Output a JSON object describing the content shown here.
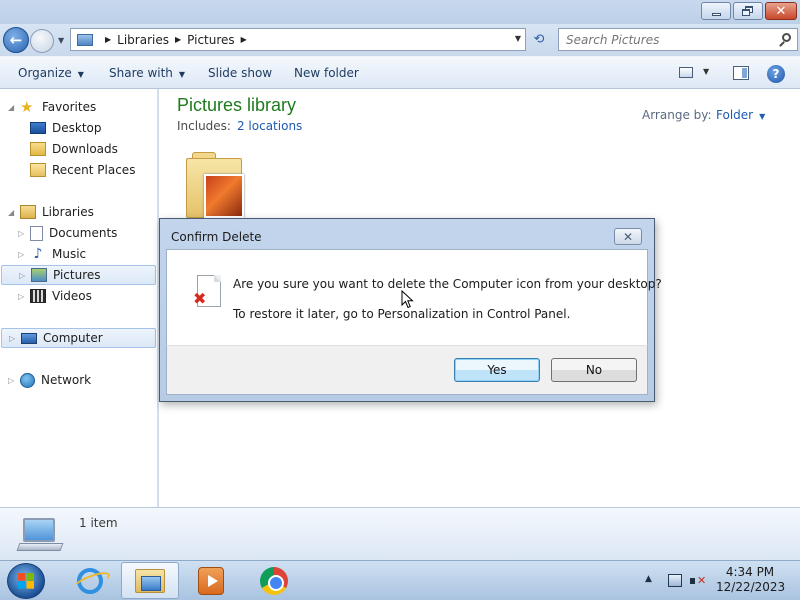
{
  "window": {
    "minimize_icon": "minimize-icon",
    "maximize_icon": "restore-icon",
    "close_icon": "close-icon",
    "close_glyph": "✕"
  },
  "address": {
    "back_icon": "back-arrow-icon",
    "back_glyph": "←",
    "forward_icon": "forward-arrow-icon",
    "history_glyph": "▼",
    "breadcrumbs": [
      "Libraries",
      "Pictures"
    ],
    "separator": "▶",
    "dropdown_glyph": "▼",
    "refresh_glyph": "⟲",
    "search_placeholder": "Search Pictures"
  },
  "toolbar": {
    "organize": "Organize",
    "share_with": "Share with",
    "slide_show": "Slide show",
    "new_folder": "New folder",
    "dropdown_glyph": "▼",
    "help_glyph": "?"
  },
  "nav": {
    "expand_glyph": "▷",
    "collapse_glyph": "◢",
    "favorites": {
      "label": "Favorites",
      "icon": "star-icon",
      "glyph": "★"
    },
    "desktop": {
      "label": "Desktop"
    },
    "downloads": {
      "label": "Downloads"
    },
    "recent_places": {
      "label": "Recent Places"
    },
    "libraries": {
      "label": "Libraries"
    },
    "documents": {
      "label": "Documents"
    },
    "music": {
      "label": "Music",
      "glyph": "♪"
    },
    "pictures": {
      "label": "Pictures",
      "selected": true
    },
    "videos": {
      "label": "Videos"
    },
    "computer": {
      "label": "Computer",
      "selected": true
    },
    "network": {
      "label": "Network"
    }
  },
  "content": {
    "title": "Pictures library",
    "includes_label": "Includes:",
    "includes_link": "2 locations",
    "arrange_label": "Arrange by:",
    "arrange_value": "Folder",
    "dropdown_glyph": "▼"
  },
  "details": {
    "item_count": "1 item"
  },
  "taskbar": {
    "apps": [
      "start-button",
      "internet-explorer",
      "windows-explorer",
      "windows-media-player",
      "google-chrome"
    ],
    "active_app": "windows-explorer",
    "tray_arrow": "▲",
    "time": "4:34 PM",
    "date": "12/22/2023"
  },
  "dialog": {
    "title": "Confirm Delete",
    "close_glyph": "✕",
    "message": "Are you sure you want to delete the Computer icon from your desktop?",
    "hint": "To restore it later, go to Personalization in Control Panel.",
    "icon_mark": "✖",
    "yes_label": "Yes",
    "no_label": "No",
    "default_button": "Yes"
  },
  "colors": {
    "library_title": "#1e7b1e",
    "link": "#1f5bb3",
    "error_mark": "#d42b1e"
  }
}
